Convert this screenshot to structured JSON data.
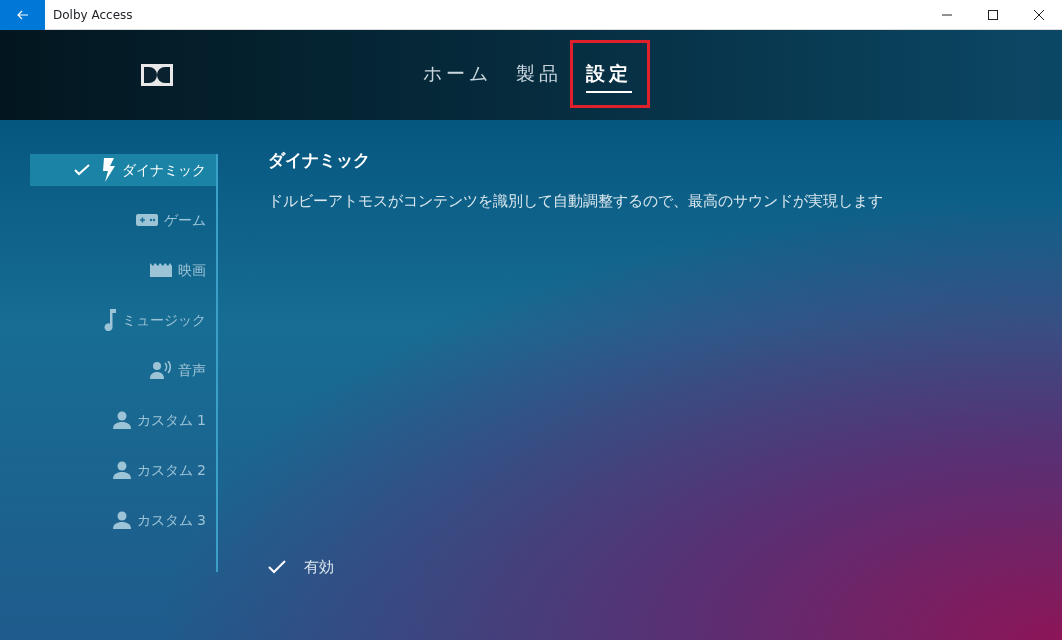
{
  "window": {
    "title": "Dolby Access"
  },
  "nav_tabs": [
    {
      "label": "ホーム",
      "selected": false,
      "highlighted": false
    },
    {
      "label": "製品",
      "selected": false,
      "highlighted": false
    },
    {
      "label": "設定",
      "selected": true,
      "highlighted": true
    }
  ],
  "sidebar": {
    "items": [
      {
        "label": "ダイナミック",
        "kind": "bolt",
        "selected": true
      },
      {
        "label": "ゲーム",
        "kind": "gamepad",
        "selected": false
      },
      {
        "label": "映画",
        "kind": "film",
        "selected": false
      },
      {
        "label": "ミュージック",
        "kind": "note",
        "selected": false
      },
      {
        "label": "音声",
        "kind": "voice",
        "selected": false
      },
      {
        "label": "カスタム 1",
        "kind": "person",
        "selected": false
      },
      {
        "label": "カスタム 2",
        "kind": "person",
        "selected": false
      },
      {
        "label": "カスタム 3",
        "kind": "person",
        "selected": false
      }
    ]
  },
  "content": {
    "title": "ダイナミック",
    "description": "ドルビーアトモスがコンテンツを識別して自動調整するので、最高のサウンドが実現します",
    "enabled": {
      "label": "有効",
      "checked": true
    }
  }
}
